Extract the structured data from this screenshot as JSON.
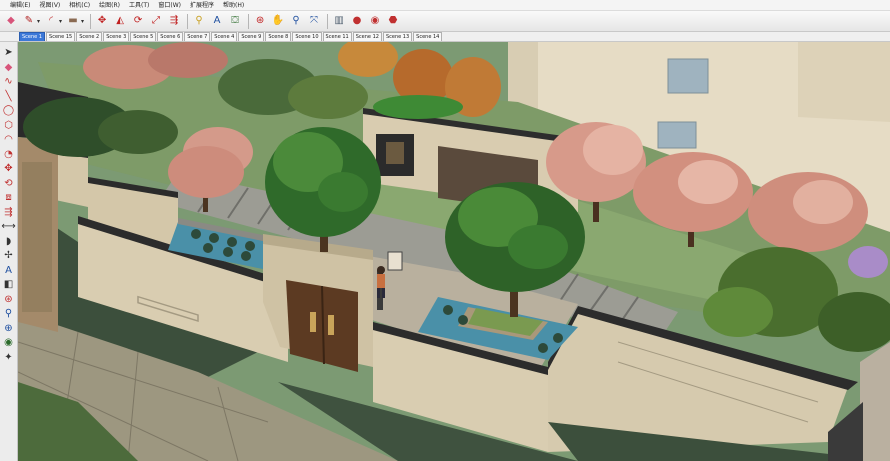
{
  "menu": [
    "编辑(E)",
    "视图(V)",
    "相机(C)",
    "绘图(R)",
    "工具(T)",
    "窗口(W)",
    "扩展程序",
    "帮助(H)"
  ],
  "toolbar": {
    "buttons": [
      {
        "name": "eraser-icon",
        "glyph": "◆",
        "color": "#d8547a"
      },
      {
        "name": "pencil-icon",
        "glyph": "✎",
        "color": "#b02020"
      },
      {
        "name": "arc-icon",
        "glyph": "◜",
        "color": "#c03030"
      },
      {
        "name": "rectangle-icon",
        "glyph": "▬",
        "color": "#8a6a52"
      },
      {
        "name": "move-icon",
        "glyph": "✥",
        "color": "#c02020"
      },
      {
        "name": "push-pull-icon",
        "glyph": "◭",
        "color": "#c02020"
      },
      {
        "name": "rotate-icon",
        "glyph": "⟳",
        "color": "#c02020"
      },
      {
        "name": "scale-icon",
        "glyph": "⤢",
        "color": "#c02020"
      },
      {
        "name": "follow-me-icon",
        "glyph": "⇶",
        "color": "#c02020"
      },
      {
        "name": "tape-measure-icon",
        "glyph": "⚲",
        "color": "#c8a020"
      },
      {
        "name": "text-icon",
        "glyph": "A",
        "color": "#2050a0"
      },
      {
        "name": "paint-bucket-icon",
        "glyph": "⛋",
        "color": "#2a6a2a"
      },
      {
        "name": "orbit-icon",
        "glyph": "⊛",
        "color": "#c02020"
      },
      {
        "name": "pan-icon",
        "glyph": "✋",
        "color": "#2050a0"
      },
      {
        "name": "zoom-icon",
        "glyph": "⚲",
        "color": "#2050a0"
      },
      {
        "name": "zoom-extents-icon",
        "glyph": "⤧",
        "color": "#2050a0"
      },
      {
        "name": "components-icon",
        "glyph": "▥",
        "color": "#506070"
      },
      {
        "name": "materials-icon",
        "glyph": "●",
        "color": "#c03030"
      },
      {
        "name": "styles-icon",
        "glyph": "◉",
        "color": "#c03030"
      },
      {
        "name": "warehouse-icon",
        "glyph": "⬣",
        "color": "#c03030"
      }
    ]
  },
  "scenes": {
    "active": "Scene 1",
    "tabs": [
      "Scene 1",
      "Scene 15",
      "Scene 2",
      "Scene 3",
      "Scene 5",
      "Scene 6",
      "Scene 7",
      "Scene 4",
      "Scene 9",
      "Scene 8",
      "Scene 10",
      "Scene 11",
      "Scene 12",
      "Scene 13",
      "Scene 14"
    ]
  },
  "palette": {
    "buttons": [
      {
        "name": "select-tool-icon",
        "glyph": "➤",
        "color": "#333333"
      },
      {
        "name": "eraser-tool-icon",
        "glyph": "◆",
        "color": "#d8547a"
      },
      {
        "name": "freehand-tool-icon",
        "glyph": "∿",
        "color": "#c03030"
      },
      {
        "name": "line-tool-icon",
        "glyph": "╲",
        "color": "#c03030"
      },
      {
        "name": "circle-tool-icon",
        "glyph": "◯",
        "color": "#c03030"
      },
      {
        "name": "polygon-tool-icon",
        "glyph": "⬡",
        "color": "#c03030"
      },
      {
        "name": "arc-tool-icon",
        "glyph": "◠",
        "color": "#c03030"
      },
      {
        "name": "pie-tool-icon",
        "glyph": "◔",
        "color": "#c03030"
      },
      {
        "name": "move-tool-icon",
        "glyph": "✥",
        "color": "#c03030"
      },
      {
        "name": "rotate-tool-icon",
        "glyph": "⟲",
        "color": "#c03030"
      },
      {
        "name": "offset-tool-icon",
        "glyph": "⧈",
        "color": "#c03030"
      },
      {
        "name": "follow-me-tool-icon",
        "glyph": "⇶",
        "color": "#c03030"
      },
      {
        "name": "dimension-tool-icon",
        "glyph": "⟷",
        "color": "#333333"
      },
      {
        "name": "protractor-tool-icon",
        "glyph": "◗",
        "color": "#333333"
      },
      {
        "name": "axes-tool-icon",
        "glyph": "✢",
        "color": "#333333"
      },
      {
        "name": "text-tool-icon",
        "glyph": "A",
        "color": "#2050a0"
      },
      {
        "name": "section-plane-tool-icon",
        "glyph": "◧",
        "color": "#333333"
      },
      {
        "name": "orbit-tool-icon",
        "glyph": "⊛",
        "color": "#c03030"
      },
      {
        "name": "zoom-window-tool-icon",
        "glyph": "⚲",
        "color": "#2050a0"
      },
      {
        "name": "zoom-extents-tool-icon",
        "glyph": "⊕",
        "color": "#2050a0"
      },
      {
        "name": "walk-tool-icon",
        "glyph": "◉",
        "color": "#2a6a2a"
      },
      {
        "name": "position-camera-tool-icon",
        "glyph": "✦",
        "color": "#333333"
      }
    ]
  }
}
